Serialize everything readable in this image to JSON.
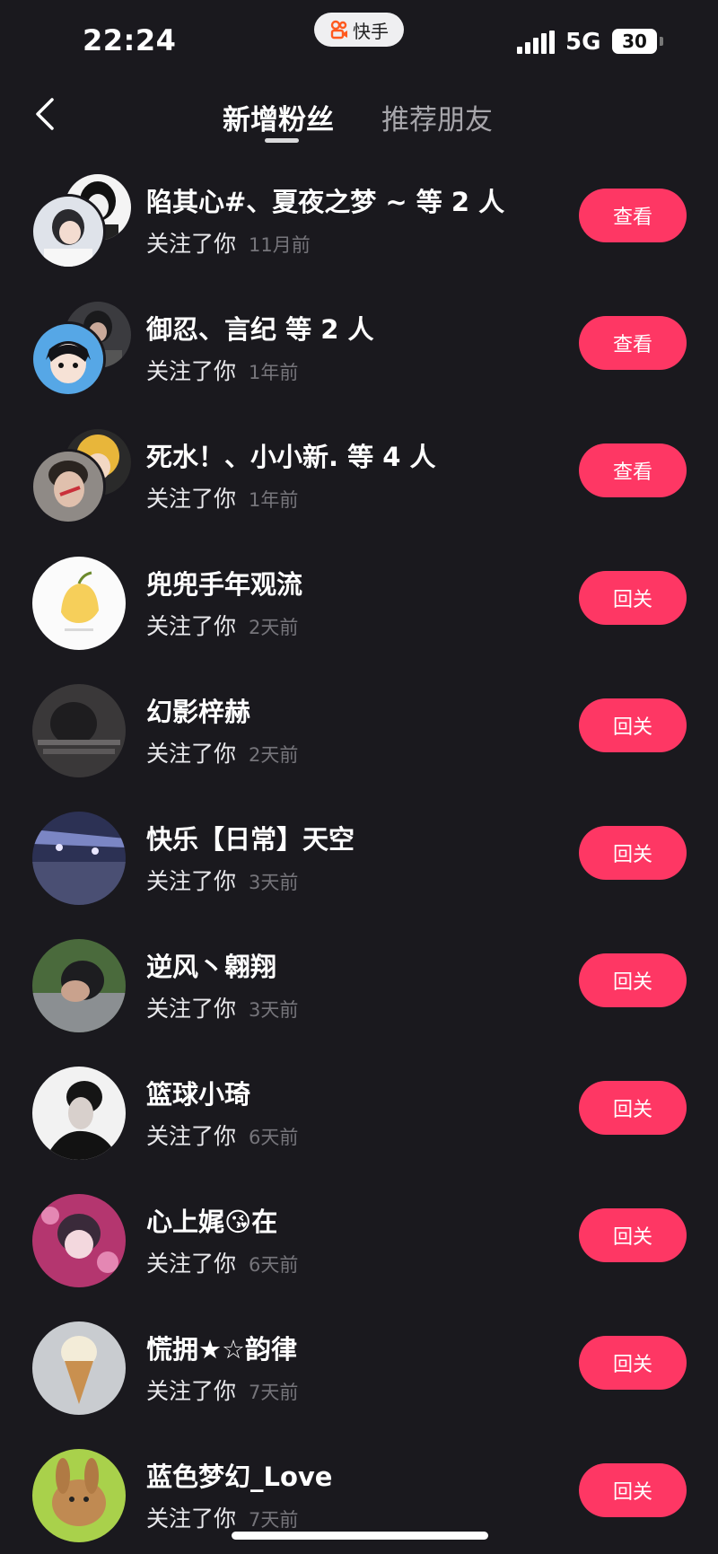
{
  "status_bar": {
    "time": "22:24",
    "app_name": "快手",
    "network": "5G",
    "battery": "30"
  },
  "header": {
    "back_icon": "chevron-left-icon",
    "tabs": [
      {
        "label": "新增粉丝",
        "active": true
      },
      {
        "label": "推荐朋友",
        "active": false
      }
    ]
  },
  "followers": [
    {
      "name": "陷其心#、夏夜之梦 ~ 等 2 人",
      "action": "关注了你",
      "time": "11月前",
      "button": "查看"
    },
    {
      "name": "御忍、言纪 等 2 人",
      "action": "关注了你",
      "time": "1年前",
      "button": "查看"
    },
    {
      "name": "死水！、小小新. 等 4 人",
      "action": "关注了你",
      "time": "1年前",
      "button": "查看"
    },
    {
      "name": "兜兜手年观流",
      "action": "关注了你",
      "time": "2天前",
      "button": "回关"
    },
    {
      "name": "幻影梓赫",
      "action": "关注了你",
      "time": "2天前",
      "button": "回关"
    },
    {
      "name": "快乐【日常】天空",
      "action": "关注了你",
      "time": "3天前",
      "button": "回关"
    },
    {
      "name": "逆风丶翱翔",
      "action": "关注了你",
      "time": "3天前",
      "button": "回关"
    },
    {
      "name": "篮球小琦",
      "action": "关注了你",
      "time": "6天前",
      "button": "回关"
    },
    {
      "name": "心上娓😘在",
      "action": "关注了你",
      "time": "6天前",
      "button": "回关"
    },
    {
      "name": "慌拥★☆韵律",
      "action": "关注了你",
      "time": "7天前",
      "button": "回关"
    },
    {
      "name": "蓝色梦幻_Love",
      "action": "关注了你",
      "time": "7天前",
      "button": "回关"
    }
  ],
  "colors": {
    "background": "#1a191e",
    "accent": "#fe3764",
    "muted": "#76757b"
  }
}
